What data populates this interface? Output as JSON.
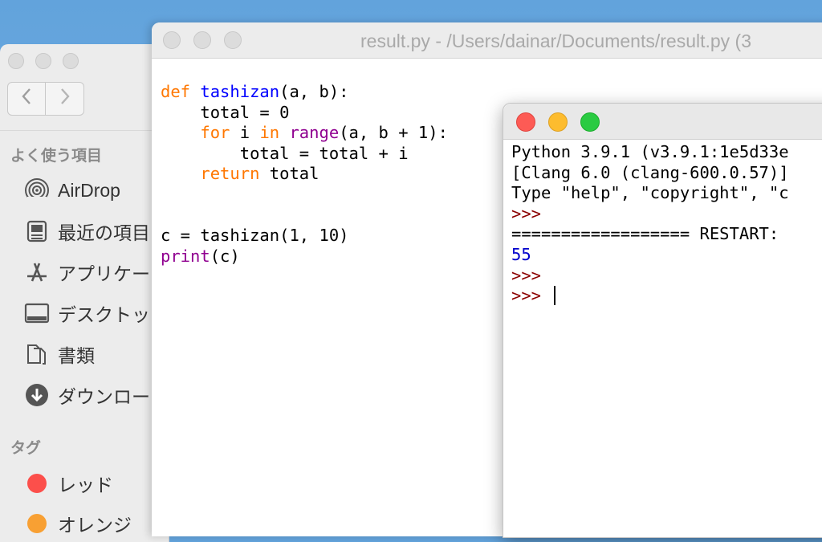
{
  "finder": {
    "nav_back": "‹",
    "nav_forward": "›",
    "favorites_title": "よく使う項目",
    "favorites": [
      {
        "label": "AirDrop",
        "icon": "airdrop-icon"
      },
      {
        "label": "最近の項目",
        "icon": "recents-icon"
      },
      {
        "label": "アプリケー",
        "icon": "applications-icon"
      },
      {
        "label": "デスクトッ",
        "icon": "desktop-icon"
      },
      {
        "label": "書類",
        "icon": "documents-icon"
      },
      {
        "label": "ダウンロー",
        "icon": "downloads-icon"
      }
    ],
    "tags_title": "タグ",
    "tags": [
      {
        "label": "レッド",
        "color": "#fc4f4b"
      },
      {
        "label": "オレンジ",
        "color": "#f8a033"
      }
    ]
  },
  "editor": {
    "title": "result.py - /Users/dainar/Documents/result.py (3",
    "code_lines": {
      "l1_kw": "def",
      "l1_fn": "tashizan",
      "l1_rest": "(a, b):",
      "l2": "    total = 0",
      "l3_indent": "    ",
      "l3_kw1": "for",
      "l3_mid": " i ",
      "l3_kw2": "in",
      "l3_sp": " ",
      "l3_bi": "range",
      "l3_rest": "(a, b + 1):",
      "l4": "        total = total + i",
      "l5_indent": "    ",
      "l5_kw": "return",
      "l5_rest": " total",
      "l8": "c = tashizan(1, 10)",
      "l9_bi": "print",
      "l9_rest": "(c)"
    }
  },
  "shell": {
    "line1": "Python 3.9.1 (v3.9.1:1e5d33e",
    "line2": "[Clang 6.0 (clang-600.0.57)]",
    "line3": "Type \"help\", \"copyright\", \"c",
    "prompt1": ">>>",
    "restart": "================== RESTART:",
    "output": "55",
    "prompt2": ">>>",
    "prompt3": ">>>"
  },
  "colors": {
    "keyword": "#ff7700",
    "function_name": "#0000ff",
    "builtin": "#900090",
    "prompt": "#8b0000",
    "output": "#0000cc",
    "close_light": "#fd5b55",
    "minimize_light": "#fdbc2e",
    "zoom_light": "#2acb42"
  }
}
